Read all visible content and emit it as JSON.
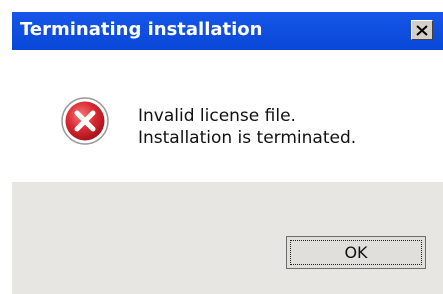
{
  "dialog": {
    "title": "Terminating installation",
    "close_icon": "close-icon",
    "message_line1": "Invalid license file.",
    "message_line2": "Installation is terminated.",
    "icon": "error-icon",
    "ok_label": "OK"
  },
  "colors": {
    "titlebar": "#0a47d8",
    "footer": "#e8e6e2",
    "error_red": "#d9232e"
  }
}
